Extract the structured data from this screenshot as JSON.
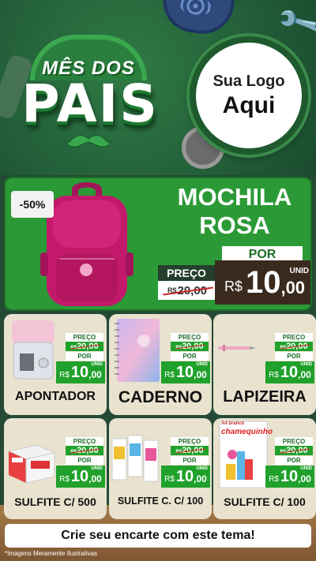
{
  "header": {
    "title_line1": "MÊS DOS",
    "title_line2": "PAIS",
    "logo_line1": "Sua Logo",
    "logo_line2": "Aqui"
  },
  "featured": {
    "discount": "-50%",
    "title": "MOCHILA ROSA",
    "por_label": "POR",
    "preco_label": "PREÇO",
    "old_currency": "R$",
    "old_price": "20,00",
    "currency": "R$",
    "price_int": "10",
    "price_cents": ",00",
    "unit": "UNID"
  },
  "cards": [
    {
      "name": "APONTADOR",
      "preco_label": "PREÇO",
      "old_currency": "R$",
      "old_price": "20,00",
      "por_label": "POR",
      "currency": "R$",
      "price_int": "10",
      "price_cents": ",00",
      "unit": "UNID"
    },
    {
      "name": "CADERNO",
      "preco_label": "PREÇO",
      "old_currency": "R$",
      "old_price": "20,00",
      "por_label": "POR",
      "currency": "R$",
      "price_int": "10",
      "price_cents": ",00",
      "unit": "UNID"
    },
    {
      "name": "LAPIZEIRA",
      "preco_label": "PREÇO",
      "old_currency": "R$",
      "old_price": "20,00",
      "por_label": "POR",
      "currency": "R$",
      "price_int": "10",
      "price_cents": ",00",
      "unit": "UNID"
    },
    {
      "name": "SULFITE C/ 500",
      "preco_label": "PREÇO",
      "old_currency": "R$",
      "old_price": "20,00",
      "por_label": "POR",
      "currency": "R$",
      "price_int": "10",
      "price_cents": ",00",
      "unit": "UNID"
    },
    {
      "name": "SULFITE C. C/ 100",
      "preco_label": "PREÇO",
      "old_currency": "R$",
      "old_price": "20,00",
      "por_label": "POR",
      "currency": "R$",
      "price_int": "10",
      "price_cents": ",00",
      "unit": "UNID"
    },
    {
      "name": "SULFITE C/ 100",
      "preco_label": "PREÇO",
      "old_currency": "R$",
      "old_price": "20,00",
      "por_label": "POR",
      "currency": "R$",
      "price_int": "10",
      "price_cents": ",00",
      "unit": "UNID"
    }
  ],
  "product_text": {
    "paper_brand": "chamequinho",
    "paper_brand_top": "A4 branco"
  },
  "cta": "Crie seu encarte com este tema!",
  "disclaimer": "*Imagens Meramente Ilustrativas",
  "colors": {
    "header_green": "#24613a",
    "featured_green": "#2b9a36",
    "price_green": "#1fa12b",
    "card_bg": "#e8e2cf",
    "price_dark": "#3a2a1e",
    "backpack_pink": "#c2196b"
  }
}
